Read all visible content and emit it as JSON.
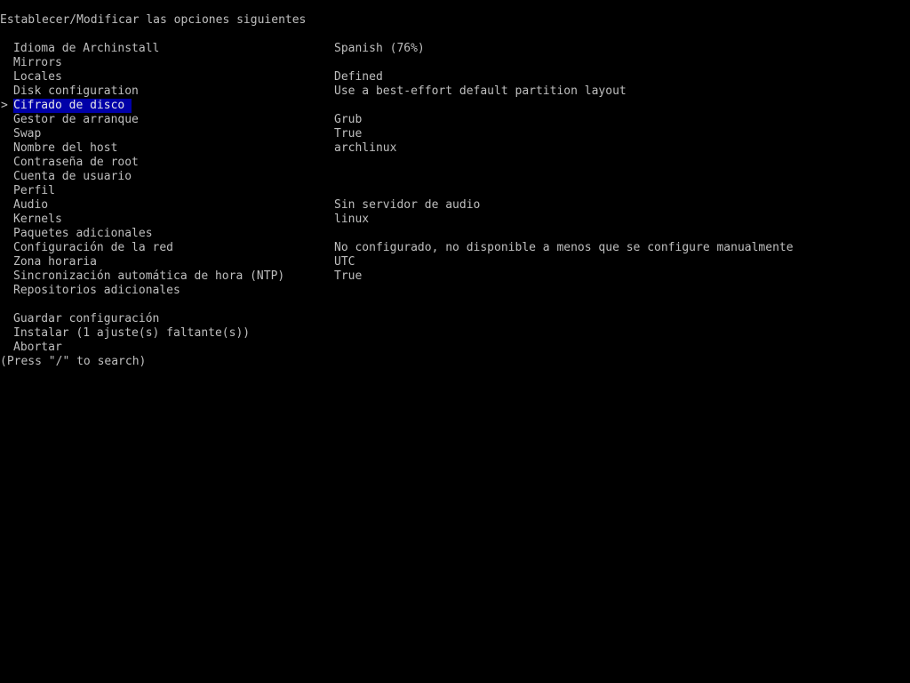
{
  "header": {
    "title": "Establecer/Modificar las opciones siguientes"
  },
  "menu": {
    "cursor_glyph": ">",
    "items": [
      {
        "label": "Idioma de Archinstall",
        "value": "Spanish (76%)"
      },
      {
        "label": "Mirrors",
        "value": ""
      },
      {
        "label": "Locales",
        "value": "Defined"
      },
      {
        "label": "Disk configuration",
        "value": "Use a best-effort default partition layout"
      },
      {
        "label": "Cifrado de disco",
        "value": "",
        "selected": true
      },
      {
        "label": "Gestor de arranque",
        "value": "Grub"
      },
      {
        "label": "Swap",
        "value": "True"
      },
      {
        "label": "Nombre del host",
        "value": "archlinux"
      },
      {
        "label": "Contraseña de root",
        "value": ""
      },
      {
        "label": "Cuenta de usuario",
        "value": ""
      },
      {
        "label": "Perfil",
        "value": ""
      },
      {
        "label": "Audio",
        "value": "Sin servidor de audio"
      },
      {
        "label": "Kernels",
        "value": "linux"
      },
      {
        "label": "Paquetes adicionales",
        "value": ""
      },
      {
        "label": "Configuración de la red",
        "value": "No configurado, no disponible a menos que se configure manualmente"
      },
      {
        "label": "Zona horaria",
        "value": "UTC"
      },
      {
        "label": "Sincronización automática de hora (NTP)",
        "value": "True"
      },
      {
        "label": "Repositorios adicionales",
        "value": ""
      }
    ],
    "actions": [
      {
        "label": "Guardar configuración"
      },
      {
        "label": "Instalar (1 ajuste(s) faltante(s))"
      },
      {
        "label": "Abortar"
      }
    ]
  },
  "footer": {
    "hint": "(Press \"/\" to search)"
  },
  "colors": {
    "background": "#000000",
    "text": "#bfbfbf",
    "highlight_bg": "#0000a8",
    "highlight_fg": "#e8e8e8"
  }
}
